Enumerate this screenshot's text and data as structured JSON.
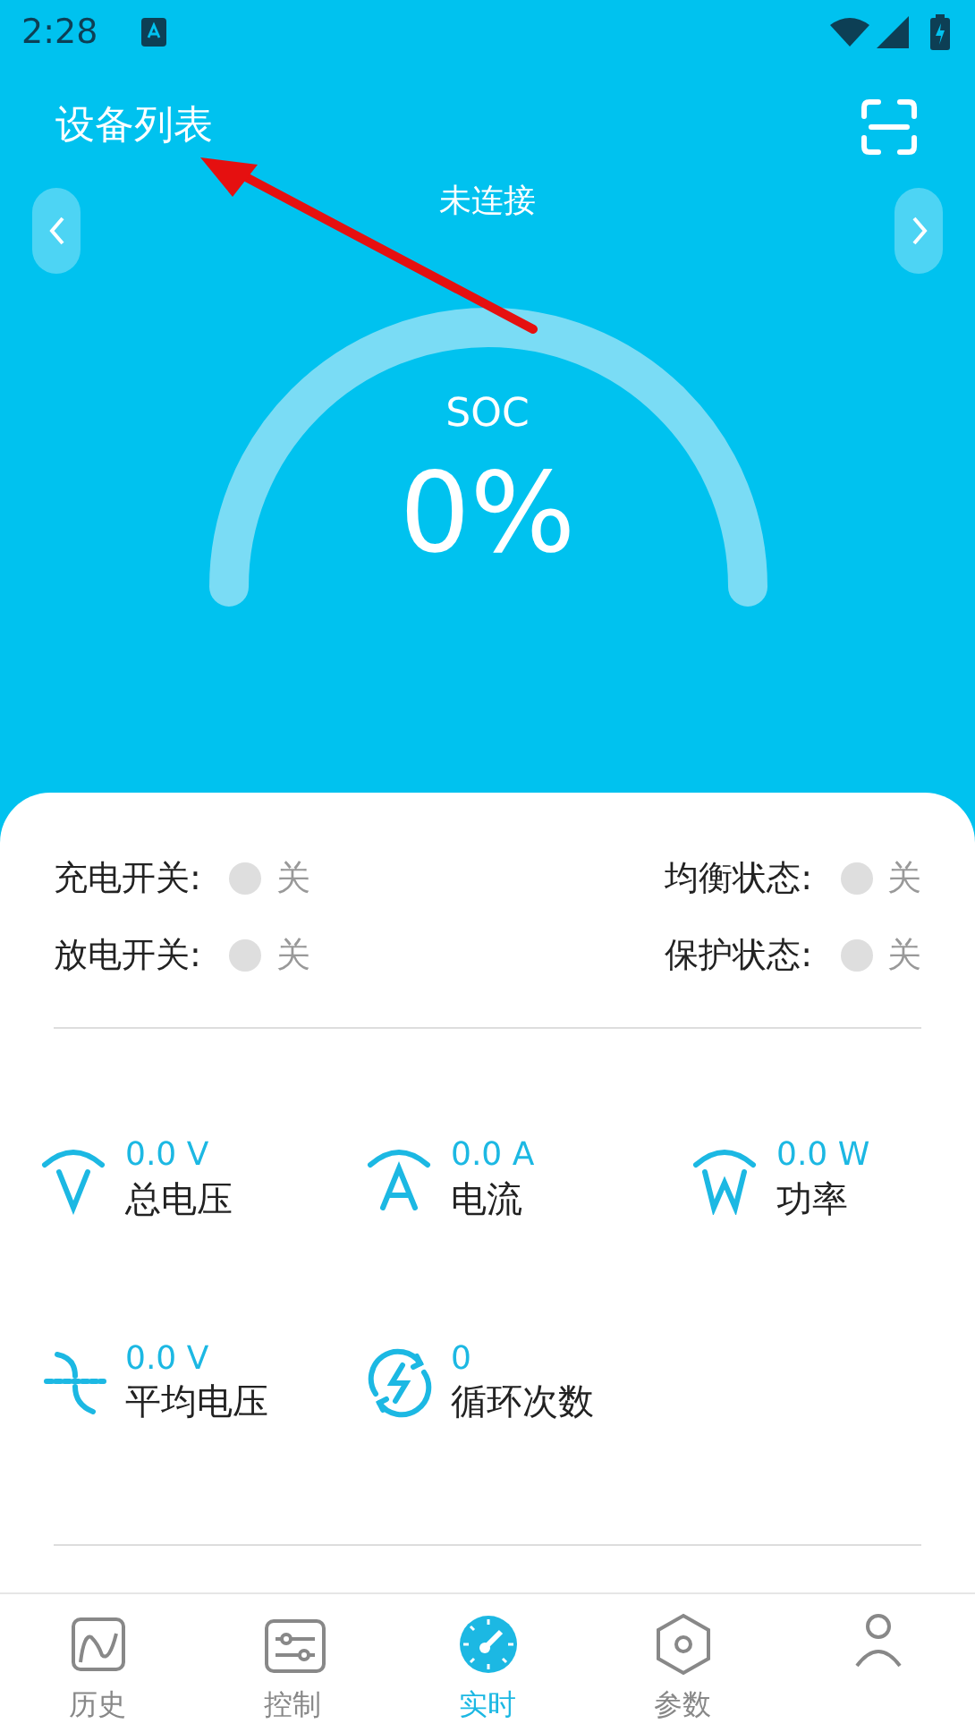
{
  "status_bar": {
    "time": "2:28"
  },
  "header": {
    "title": "设备列表",
    "connection": "未连接"
  },
  "gauge": {
    "label": "SOC",
    "value": "0%"
  },
  "switches": [
    {
      "label": "充电开关:",
      "on": false,
      "state": "关"
    },
    {
      "label": "均衡状态:",
      "on": false,
      "state": "关"
    },
    {
      "label": "放电开关:",
      "on": false,
      "state": "关"
    },
    {
      "label": "保护状态:",
      "on": false,
      "state": "关"
    }
  ],
  "metrics": [
    {
      "kind": "voltage",
      "value": "0.0 V",
      "label": "总电压"
    },
    {
      "kind": "current",
      "value": "0.0 A",
      "label": "电流"
    },
    {
      "kind": "power",
      "value": "0.0 W",
      "label": "功率"
    },
    {
      "kind": "average",
      "value": "0.0 V",
      "label": "平均电压"
    },
    {
      "kind": "cycles",
      "value": "0",
      "label": "循环次数"
    }
  ],
  "tabs": [
    {
      "kind": "history",
      "label": "历史",
      "selected": false
    },
    {
      "kind": "control",
      "label": "控制",
      "selected": false
    },
    {
      "kind": "realtime",
      "label": "实时",
      "selected": true
    },
    {
      "kind": "params",
      "label": "参数",
      "selected": false
    },
    {
      "kind": "person",
      "selected": false
    }
  ]
}
